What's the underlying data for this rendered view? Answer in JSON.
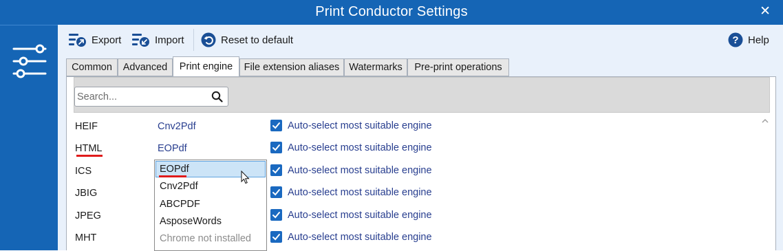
{
  "window": {
    "title": "Print Conductor Settings",
    "close_glyph": "✕"
  },
  "toolbar": {
    "export_label": "Export",
    "import_label": "Import",
    "reset_label": "Reset to default",
    "help_label": "Help"
  },
  "tabs": [
    {
      "label": "Common"
    },
    {
      "label": "Advanced"
    },
    {
      "label": "Print engine"
    },
    {
      "label": "File extension aliases"
    },
    {
      "label": "Watermarks"
    },
    {
      "label": "Pre-print operations"
    }
  ],
  "active_tab": "Print engine",
  "search": {
    "placeholder": "Search..."
  },
  "rows": [
    {
      "extension": "HEIF",
      "engine": "Cnv2Pdf",
      "auto_select_label": "Auto-select most suitable engine",
      "auto_select_checked": true
    },
    {
      "extension": "HTML",
      "engine": "EOPdf",
      "auto_select_label": "Auto-select most suitable engine",
      "auto_select_checked": true
    },
    {
      "extension": "ICS",
      "engine": "",
      "auto_select_label": "Auto-select most suitable engine",
      "auto_select_checked": true
    },
    {
      "extension": "JBIG",
      "engine": "",
      "auto_select_label": "Auto-select most suitable engine",
      "auto_select_checked": true
    },
    {
      "extension": "JPEG",
      "engine": "",
      "auto_select_label": "Auto-select most suitable engine",
      "auto_select_checked": true
    },
    {
      "extension": "MHT",
      "engine": "",
      "auto_select_label": "Auto-select most suitable engine",
      "auto_select_checked": true
    }
  ],
  "engine_dropdown": {
    "options": [
      {
        "label": "EOPdf",
        "selected": true,
        "enabled": true
      },
      {
        "label": "Cnv2Pdf",
        "selected": false,
        "enabled": true
      },
      {
        "label": "ABCPDF",
        "selected": false,
        "enabled": true
      },
      {
        "label": "AsposeWords",
        "selected": false,
        "enabled": true
      },
      {
        "label": "Chrome not installed",
        "selected": false,
        "enabled": false
      }
    ]
  },
  "colors": {
    "title_bar": "#1565b5",
    "content_bg": "#e9f1fb",
    "link_text": "#283e8f",
    "checkbox": "#1a69c0",
    "highlight_underline": "#e01b1b",
    "selected_option_bg": "#cce4f7"
  },
  "icons": {
    "export": "export-icon",
    "import": "import-icon",
    "reset": "undo-icon",
    "help": "help-icon",
    "search": "search-icon",
    "sidebar": "settings-sliders-icon"
  }
}
